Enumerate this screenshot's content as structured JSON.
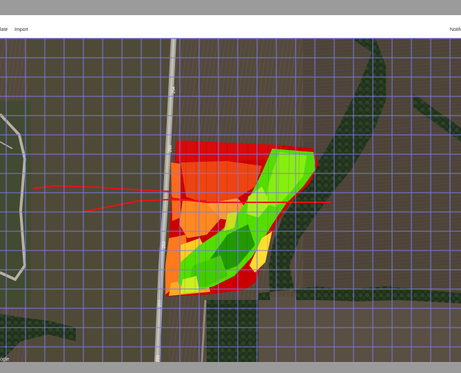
{
  "toolbar": {
    "left_label": "late",
    "import_label": "Import",
    "right_label": "Notifi"
  },
  "map": {
    "attribution": "ogle",
    "road_labels": [
      "254",
      "253",
      "253",
      "253",
      "253"
    ],
    "colors": {
      "grid_line": "#7b7bea",
      "low": "#cc0000",
      "mid": "#ff9900",
      "high": "#33dd00",
      "track_line": "#ee1111"
    }
  }
}
